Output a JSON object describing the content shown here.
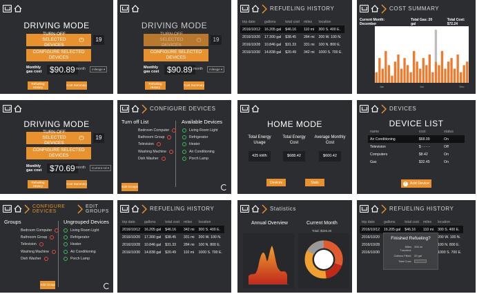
{
  "p1": {
    "title": "DRIVING MODE",
    "btn_off": "TURN OFF SELECTED DEVICES",
    "btn_cfg": "CONFIGURE SELECTED DEVICES",
    "count": "19",
    "cost_label": "Monthly gas cost",
    "cost": "$90.89",
    "period_label": "month",
    "period_value": "mileage",
    "btn_refuel": "Refueling History",
    "btn_cost": "Cost Summary"
  },
  "p2": {
    "title": "DRIVING MODE",
    "btn_off": "TURN OFF SELECTED DEVICES",
    "btn_cfg": "CONFIGURE SELECTED DEVICES",
    "count": "19",
    "cost_label": "Monthly gas cost",
    "cost": "$90.89",
    "period_label": "month",
    "period_value": "mileage",
    "btn_refuel": "Refueling History",
    "btn_cost": "Cost Summary"
  },
  "p3": {
    "header": "REFUELING HISTORY",
    "cols": [
      "trip date",
      "gallons",
      "total cost",
      "miles",
      "location"
    ],
    "rows": [
      [
        "2016/10/12",
        "16.205 gal",
        "$46.16",
        "110 mi",
        "300 S. 400 E."
      ],
      [
        "2016/10/20",
        "17.300 gal",
        "$38.45",
        "284 mi",
        "200 W. 100 N."
      ],
      [
        "2016/10/28",
        "10.846 gal",
        "$31.33",
        "331 mi",
        "100 N. 800 E."
      ],
      [
        "2016/10/30",
        "14.838 gal",
        "$20.49",
        "342 mi",
        "1000 S. 700 E."
      ]
    ]
  },
  "p4": {
    "header": "COST SUMMARY",
    "current_month": "Current Month: December",
    "total_gas": "Total Gas: 20 gal",
    "total_cost": "Total Cost: $72.24",
    "xticks": [
      "Jan",
      "Jun",
      "Dec"
    ]
  },
  "chart_data": {
    "type": "bar",
    "title": "",
    "xlabel": "",
    "ylabel": "",
    "series": [
      {
        "name": "",
        "values": [
          3,
          7,
          4,
          9,
          5,
          2,
          6,
          8,
          4,
          7,
          5,
          3,
          9,
          6,
          4,
          7,
          5,
          8,
          3,
          6,
          5,
          9,
          4,
          6,
          7,
          4,
          8,
          3,
          5,
          6
        ]
      }
    ],
    "highlight_index": 19,
    "highlight_value": 15,
    "ylim": [
      0,
      16
    ]
  },
  "p5": {
    "title": "DRIVING MODE",
    "btn_off": "TURN OFF SELECTED DEVICES",
    "btn_cfg": "CONFIGURE SELECTED DEVICES",
    "count": "19",
    "cost_label": "Monthly gas cost",
    "cost": "$70.69",
    "period_label": "month",
    "period_value": "Current Ad",
    "btn_refuel": "Refueling History",
    "btn_cost": "Cost Summary"
  },
  "p6": {
    "header": "CONFIGURE DEVICES",
    "left_title": "Turn off List",
    "right_title": "Available Devices",
    "left": [
      "Bedroom Computer",
      "Bathroom Group",
      "Television",
      "Washing Machine",
      "Dish Washer"
    ],
    "right": [
      "Living Room Light",
      "Refrigerator",
      "Heater",
      "Air Conditioning",
      "Porch Lamp"
    ],
    "btn": "Edit Groups"
  },
  "p7": {
    "title": "HOME MODE",
    "c1_label": "Total Energy Usage",
    "c1_value": "425 kWh",
    "c2_label": "Total Energy Cost",
    "c2_value": "$688.42",
    "c3_label": "Average Monthly Cost",
    "c3_value": "$600.42",
    "btn_devices": "Devices",
    "btn_stats": "Stats"
  },
  "p8": {
    "header": "DEVICES",
    "title": "DEVICE LIST",
    "cols": [
      "name",
      "cost",
      "status"
    ],
    "rows": [
      [
        "Air Conditioning",
        "$68.99",
        "On"
      ],
      [
        "Television",
        "$ - - - -",
        "Off"
      ],
      [
        "Computers",
        "$8.42",
        "On"
      ],
      [
        "Gas",
        "$32.45",
        "On"
      ]
    ],
    "btn": "Add Device"
  },
  "p9": {
    "header1": "CONFIGURE DEVICES",
    "header2": "EDIT GROUPS",
    "left_title": "Groups",
    "right_title": "Ungrouped Devices",
    "left": [
      "Bedroom Computer",
      "Bathroom Group",
      "Television",
      "Washing Machine",
      "Dish Washer"
    ],
    "right": [
      "Living Room Light",
      "Refrigerator",
      "Heater",
      "Air Conditioning",
      "Porch Lamp"
    ],
    "btn": "Add Group"
  },
  "p10": {
    "header": "REFUELING HISTORY",
    "cols": [
      "trip date",
      "gallons",
      "total cost",
      "miles",
      "location"
    ],
    "rows": [
      [
        "2016/10/12",
        "16.205 gal",
        "$46.16",
        "342 mi",
        "300 S. 400 E."
      ],
      [
        "2016/10/20",
        "17.300 gal",
        "$38.45",
        "331 mi",
        "200 W. 100 N."
      ],
      [
        "2016/10/28",
        "10.846 gal",
        "$31.33",
        "284 mi",
        "100 N. 800 E."
      ],
      [
        "2016/10/30",
        "14.838 gal",
        "$20.49",
        "110 mi",
        "1000 S. 700 E."
      ]
    ]
  },
  "p11": {
    "header": "Statistics",
    "t1": "Annual Overview",
    "t2": "Current Month",
    "total": "Total: $326.40"
  },
  "p12": {
    "header": "REFUELING HISTORY",
    "cols": [
      "trip date",
      "gallons",
      "total cost",
      "miles",
      "location"
    ],
    "rows": [
      [
        "2016/10/12",
        "16.205 gal",
        "$46.16",
        "110 mi",
        "300 S. 400 E."
      ],
      [
        "2016/10/20",
        "",
        "",
        "",
        "200 W. 100 N."
      ],
      [
        "2016/10/28",
        "",
        "",
        "",
        "100 N. 800 E."
      ],
      [
        "2016/10/30",
        "",
        "",
        "",
        "1000 S. 700 E."
      ]
    ],
    "popup_title": "Finished Refueling?",
    "f1": "Miles Traveled:",
    "f1v": "398 mi",
    "f2": "Gallons Filled:",
    "f2v": "20 gal",
    "f3": "Total Cost:"
  }
}
